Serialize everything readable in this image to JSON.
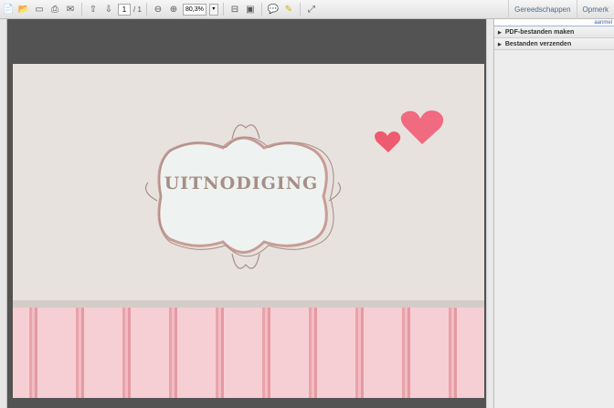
{
  "toolbar": {
    "page_current": "1",
    "page_total": "/ 1",
    "zoom": "80,3%",
    "zoom_dropdown": "▾"
  },
  "tabs": [
    "Gereedschappen",
    "Opmerk"
  ],
  "panel": {
    "header": "aanmel",
    "sections": [
      "PDF-bestanden maken",
      "Bestanden verzenden"
    ]
  },
  "document": {
    "title": "UITNODIGING"
  },
  "colors": {
    "page_bg": "#e8e2df",
    "heart": "#f06a80",
    "stripe": "#f2bcc3"
  }
}
